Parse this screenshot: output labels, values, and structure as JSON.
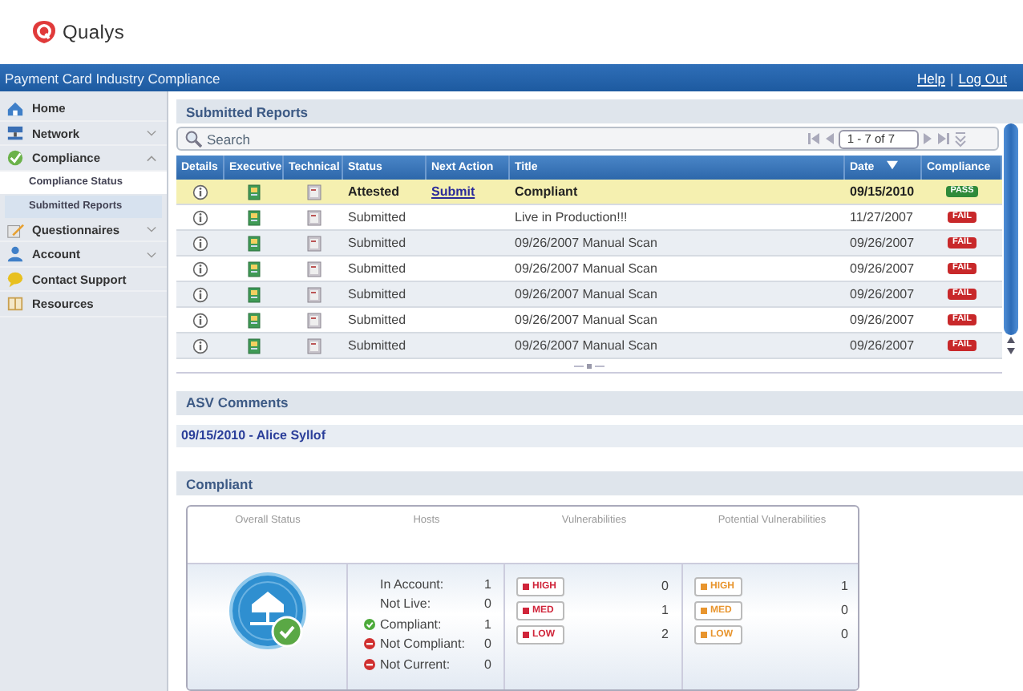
{
  "brand": {
    "name": "Qualys"
  },
  "title_bar": {
    "title": "Payment Card Industry Compliance",
    "links": [
      "Help",
      "Log Out"
    ],
    "separator": "|"
  },
  "sidebar": {
    "items": [
      {
        "label": "Home"
      },
      {
        "label": "Network",
        "expanded": false
      },
      {
        "label": "Compliance",
        "expanded": true,
        "children": [
          {
            "label": "Compliance Status",
            "selected": false
          },
          {
            "label": "Submitted Reports",
            "selected": true
          }
        ]
      },
      {
        "label": "Questionnaires",
        "expanded": false
      },
      {
        "label": "Account",
        "expanded": false
      },
      {
        "label": "Contact Support"
      },
      {
        "label": "Resources"
      }
    ]
  },
  "reports": {
    "title": "Submitted Reports",
    "search": {
      "placeholder": "Search"
    },
    "pager": "1 - 7 of 7",
    "columns": [
      "Details",
      "Executive",
      "Technical",
      "Status",
      "Next Action",
      "Title",
      "Date",
      "Compliance"
    ],
    "rows": [
      {
        "status": "Attested",
        "next_action": "Submit",
        "title": "Compliant",
        "date": "09/15/2010",
        "compliance": "PASS",
        "passed": true,
        "selected": true
      },
      {
        "status": "Submitted",
        "title": "Live in Production!!!",
        "date": "11/27/2007",
        "compliance": "FAIL",
        "passed": false,
        "selected": false
      },
      {
        "status": "Submitted",
        "title": "09/26/2007 Manual Scan",
        "date": "09/26/2007",
        "compliance": "FAIL",
        "passed": false,
        "selected": false
      },
      {
        "status": "Submitted",
        "title": "09/26/2007 Manual Scan",
        "date": "09/26/2007",
        "compliance": "FAIL",
        "passed": false,
        "selected": false
      },
      {
        "status": "Submitted",
        "title": "09/26/2007 Manual Scan",
        "date": "09/26/2007",
        "compliance": "FAIL",
        "passed": false,
        "selected": false
      },
      {
        "status": "Submitted",
        "title": "09/26/2007 Manual Scan",
        "date": "09/26/2007",
        "compliance": "FAIL",
        "passed": false,
        "selected": false
      },
      {
        "status": "Submitted",
        "title": "09/26/2007 Manual Scan",
        "date": "09/26/2007",
        "compliance": "FAIL",
        "passed": false,
        "selected": false
      }
    ]
  },
  "asv_comments": {
    "title": "ASV Comments",
    "entries": [
      "09/15/2010 - Alice Syllof"
    ]
  },
  "compliance": {
    "title": "Compliant",
    "columns": [
      "Overall Status",
      "Hosts",
      "Vulnerabilities",
      "Potential Vulnerabilities"
    ],
    "overall_compliant": true,
    "hosts": [
      {
        "label": "In Account:",
        "value": "1",
        "kind": "plain"
      },
      {
        "label": "Not Live:",
        "value": "0",
        "kind": "plain"
      },
      {
        "label": "Compliant:",
        "value": "1",
        "kind": "ok"
      },
      {
        "label": "Not Compliant:",
        "value": "0",
        "kind": "bad"
      },
      {
        "label": "Not Current:",
        "value": "0",
        "kind": "bad"
      }
    ],
    "vulnerability_groups": [
      {
        "kind": "confirmed",
        "items": [
          {
            "label": "HIGH",
            "count": "0"
          },
          {
            "label": "MED",
            "count": "1"
          },
          {
            "label": "LOW",
            "count": "2"
          }
        ]
      },
      {
        "kind": "potential",
        "items": [
          {
            "label": "HIGH",
            "count": "1"
          },
          {
            "label": "MED",
            "count": "0"
          },
          {
            "label": "LOW",
            "count": "0"
          }
        ]
      }
    ]
  }
}
